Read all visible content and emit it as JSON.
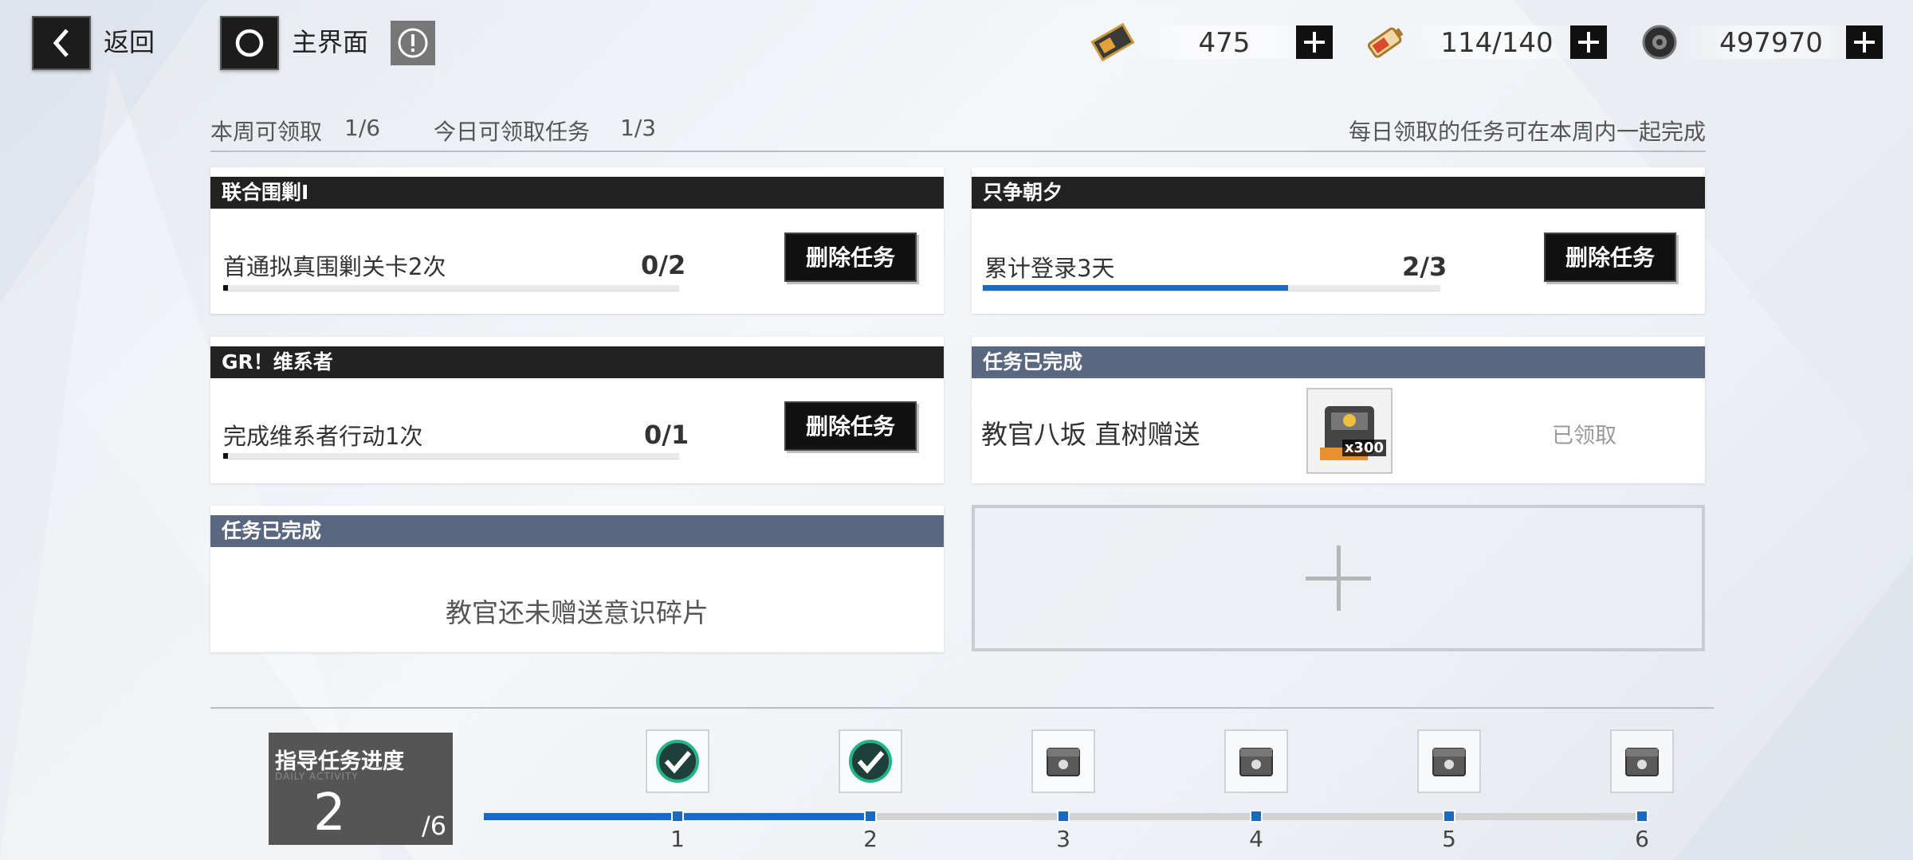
{
  "topbar": {
    "back_label": "返回",
    "home_label": "主界面",
    "resources": [
      {
        "icon": "ticket-icon",
        "value": "475"
      },
      {
        "icon": "battery-icon",
        "value": "114/140"
      },
      {
        "icon": "gear-coin-icon",
        "value": "497970"
      }
    ]
  },
  "info": {
    "weekly_label": "本周可领取",
    "weekly_value": "1/6",
    "daily_label": "今日可领取任务",
    "daily_value": "1/3",
    "hint": "每日领取的任务可在本周内一起完成"
  },
  "cards": [
    {
      "title": "联合围剿Ⅰ",
      "task": "首通拟真围剿关卡2次",
      "count": "0/2",
      "progress": 0.0,
      "button": "删除任务"
    },
    {
      "title": "只争朝夕",
      "task": "累计登录3天",
      "count": "2/3",
      "progress": 0.6667,
      "button": "删除任务"
    },
    {
      "title": "GR！维系者",
      "task": "完成维系者行动1次",
      "count": "0/1",
      "progress": 0.0,
      "button": "删除任务"
    },
    {
      "title": "任务已完成",
      "task": "教官八坂 直树赠送",
      "gift_qty": "x300",
      "status": "已领取"
    },
    {
      "title": "任务已完成",
      "message": "教官还未赠送意识碎片"
    }
  ],
  "guide": {
    "title": "指导任务进度",
    "subtitle": "DAILY ACTIVITY",
    "value": "2",
    "total": "/6",
    "progress": 0.333,
    "steps": [
      {
        "label": "1",
        "state": "claimed"
      },
      {
        "label": "2",
        "state": "claimed"
      },
      {
        "label": "3",
        "state": "locked"
      },
      {
        "label": "4",
        "state": "locked"
      },
      {
        "label": "5",
        "state": "locked"
      },
      {
        "label": "6",
        "state": "locked"
      }
    ]
  },
  "colors": {
    "accent": "#1a6bbf",
    "header_dark": "#222222",
    "header_done": "#5a6780",
    "check_green": "#23b58a"
  }
}
